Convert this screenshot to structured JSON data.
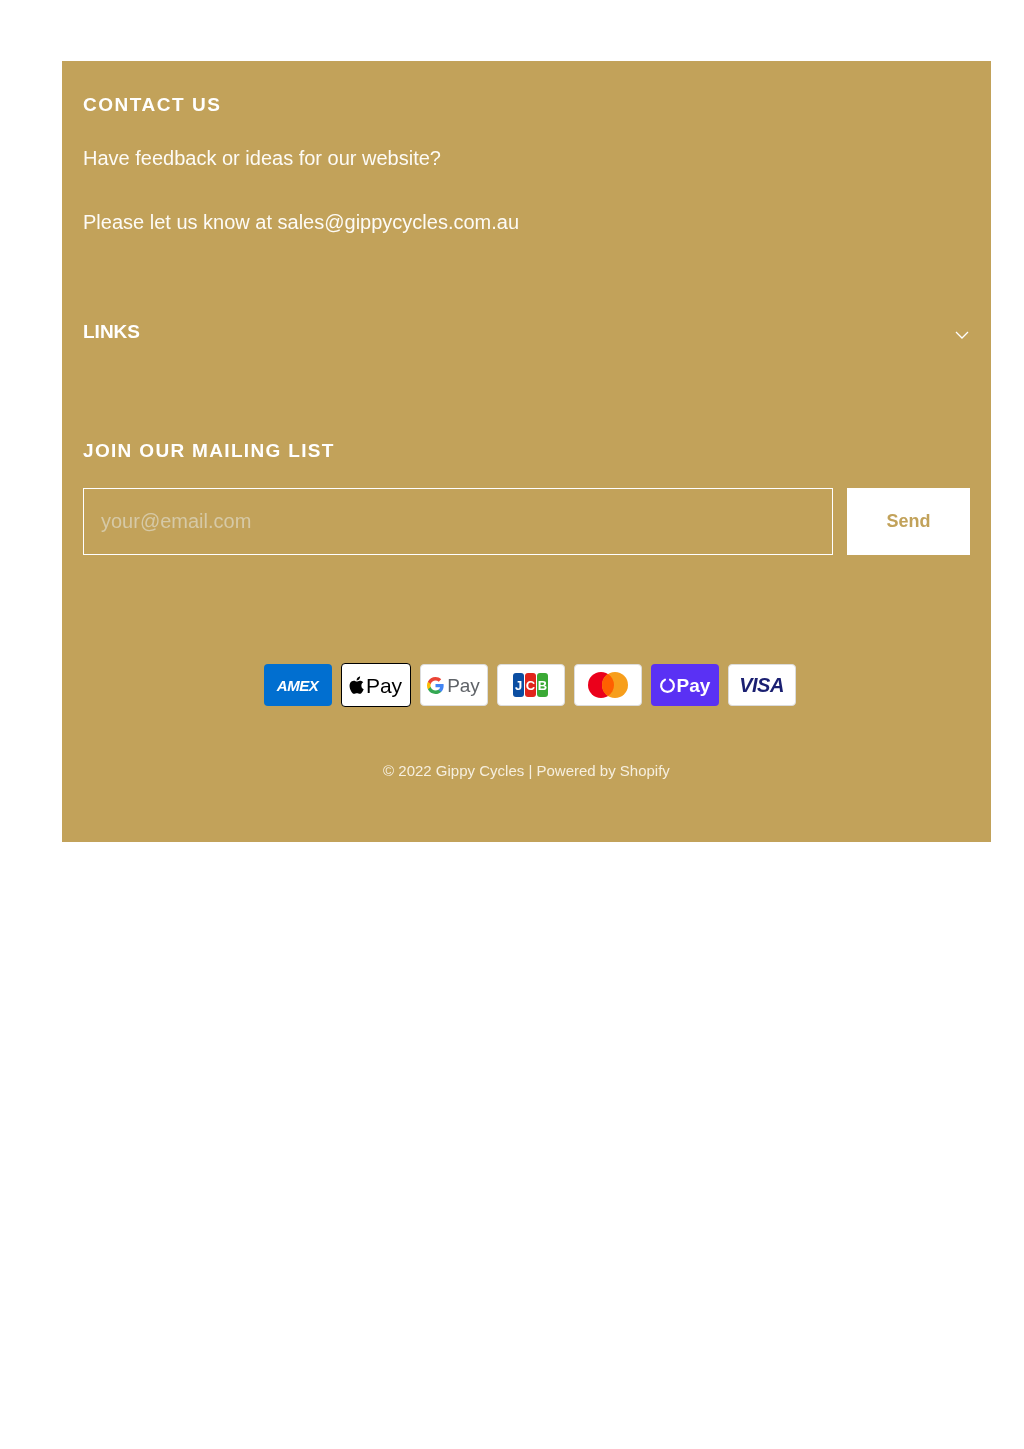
{
  "contact": {
    "heading": "CONTACT US",
    "paragraphs": [
      "Have feedback or ideas for our website?",
      "Please let us know at sales@gippycycles.com.au"
    ]
  },
  "links": {
    "heading": "LINKS",
    "expanded": false
  },
  "mailing_list": {
    "heading": "JOIN OUR MAILING LIST",
    "email_field": {
      "placeholder": "your@email.com"
    },
    "button": "Send"
  },
  "payment_methods": [
    {
      "kind": "amex",
      "label": "AMEX"
    },
    {
      "kind": "apple_pay",
      "label": "Pay"
    },
    {
      "kind": "google_pay",
      "label": "Pay"
    },
    {
      "kind": "jcb",
      "label": "JCB"
    },
    {
      "kind": "mastercard"
    },
    {
      "kind": "shop_pay",
      "label": "Pay"
    },
    {
      "kind": "visa",
      "label": "VISA"
    }
  ],
  "copyright": "© 2022 Gippy Cycles | Powered by Shopify"
}
